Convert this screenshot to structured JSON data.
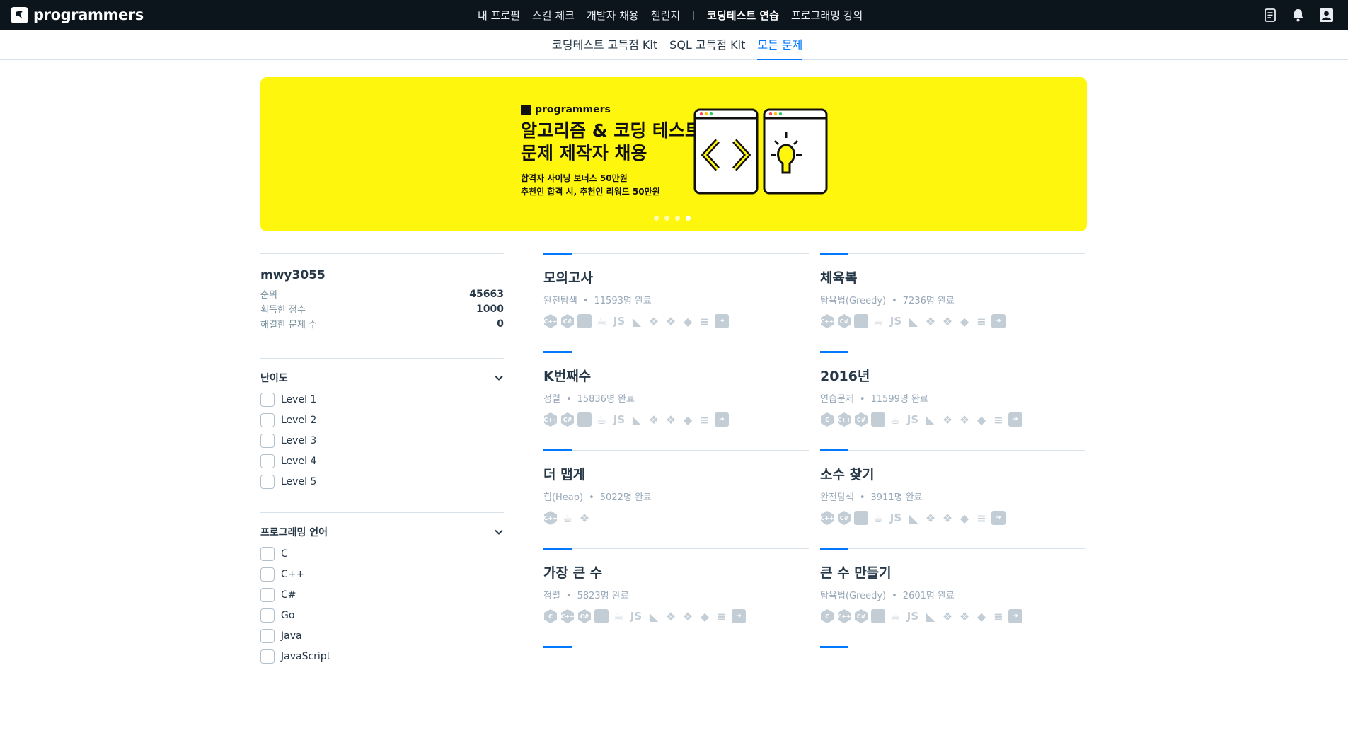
{
  "header": {
    "logo_text": "programmers",
    "nav": [
      "내 프로필",
      "스킬 체크",
      "개발자 채용",
      "챌린지",
      "코딩테스트 연습",
      "프로그래밍 강의"
    ],
    "active_nav": "코딩테스트 연습",
    "icons": [
      "document-icon",
      "bell-icon",
      "user-icon"
    ]
  },
  "subnav": {
    "tabs": [
      "코딩테스트 고득점 Kit",
      "SQL 고득점 Kit",
      "모든 문제"
    ],
    "active": "모든 문제"
  },
  "banner": {
    "brand": "programmers",
    "title_line1": "알고리즘 & 코딩 테스트",
    "title_line2": "문제 제작자 채용",
    "sub_line1": "합격자 사이닝 보너스 50만원",
    "sub_line2": "추천인 합격 시, 추천인 리워드 50만원",
    "slide_count": 4,
    "active_slide": 4,
    "bg_color": "#fff60d"
  },
  "profile": {
    "username": "mwy3055",
    "rank_label": "순위",
    "rank_value": "45663",
    "score_label": "획득한 점수",
    "score_value": "1000",
    "solved_label": "해결한 문제 수",
    "solved_value": "0"
  },
  "filters": {
    "difficulty": {
      "title": "난이도",
      "options": [
        "Level 1",
        "Level 2",
        "Level 3",
        "Level 4",
        "Level 5"
      ]
    },
    "language": {
      "title": "프로그래밍 언어",
      "options": [
        "C",
        "C++",
        "C#",
        "Go",
        "Java",
        "JavaScript"
      ]
    }
  },
  "problems": [
    {
      "title": "모의고사",
      "category": "완전탐색",
      "solved": "11593명 완료",
      "langs": [
        "cpp",
        "csharp",
        "go",
        "java",
        "js",
        "kotlin",
        "python2",
        "python3",
        "ruby",
        "scala",
        "swift"
      ]
    },
    {
      "title": "체육복",
      "category": "탐욕법(Greedy)",
      "solved": "7236명 완료",
      "langs": [
        "cpp",
        "csharp",
        "go",
        "java",
        "js",
        "kotlin",
        "python2",
        "python3",
        "ruby",
        "scala",
        "swift"
      ]
    },
    {
      "title": "K번째수",
      "category": "정렬",
      "solved": "15836명 완료",
      "langs": [
        "cpp",
        "csharp",
        "go",
        "java",
        "js",
        "kotlin",
        "python2",
        "python3",
        "ruby",
        "scala",
        "swift"
      ]
    },
    {
      "title": "2016년",
      "category": "연습문제",
      "solved": "11599명 완료",
      "langs": [
        "c",
        "cpp",
        "csharp",
        "go",
        "java",
        "js",
        "kotlin",
        "python2",
        "python3",
        "ruby",
        "scala",
        "swift"
      ]
    },
    {
      "title": "더 맵게",
      "category": "힙(Heap)",
      "solved": "5022명 완료",
      "langs": [
        "cpp",
        "java",
        "python3"
      ]
    },
    {
      "title": "소수 찾기",
      "category": "완전탐색",
      "solved": "3911명 완료",
      "langs": [
        "cpp",
        "csharp",
        "go",
        "java",
        "js",
        "kotlin",
        "python2",
        "python3",
        "ruby",
        "scala",
        "swift"
      ]
    },
    {
      "title": "가장 큰 수",
      "category": "정렬",
      "solved": "5823명 완료",
      "langs": [
        "c",
        "cpp",
        "csharp",
        "go",
        "java",
        "js",
        "kotlin",
        "python2",
        "python3",
        "ruby",
        "scala",
        "swift"
      ]
    },
    {
      "title": "큰 수 만들기",
      "category": "탐욕법(Greedy)",
      "solved": "2601명 완료",
      "langs": [
        "c",
        "cpp",
        "csharp",
        "go",
        "java",
        "js",
        "kotlin",
        "python2",
        "python3",
        "ruby",
        "scala",
        "swift"
      ]
    }
  ],
  "meta_separator": "•"
}
